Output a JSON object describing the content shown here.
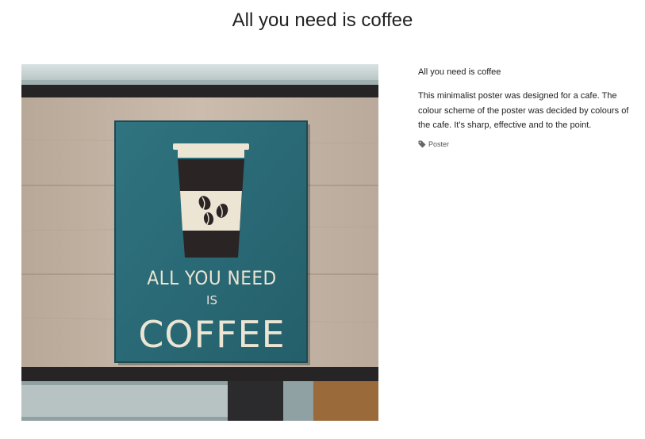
{
  "page": {
    "title": "All you need is coffee"
  },
  "item": {
    "title": "All you need is coffee",
    "description": "This minimalist poster was designed for a cafe. The colour scheme of the poster was decided by colours of the cafe. It's sharp, effective and to the point.",
    "tags": [
      {
        "label": "Poster",
        "icon": "tag-icon"
      }
    ]
  },
  "poster": {
    "line1": "ALL YOU NEED",
    "line2": "IS",
    "line3": "COFFEE"
  },
  "colors": {
    "poster": "#2b6f7c",
    "wood": "#c3b4a5",
    "cup": "#2a2425",
    "sleeve": "#ece5d3"
  }
}
